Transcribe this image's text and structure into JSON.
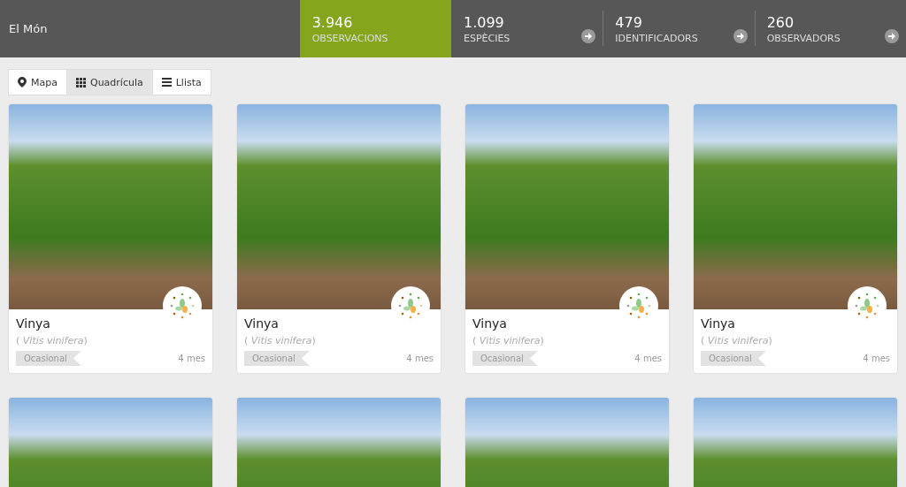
{
  "header": {
    "place": "El Món",
    "stats": [
      {
        "value": "3.946",
        "label": "OBSERVACIONS",
        "selected": true
      },
      {
        "value": "1.099",
        "label": "ESPÈCIES",
        "selected": false
      },
      {
        "value": "479",
        "label": "IDENTIFICADORS",
        "selected": false
      },
      {
        "value": "260",
        "label": "OBSERVADORS",
        "selected": false
      }
    ]
  },
  "view_tabs": [
    {
      "label": "Mapa",
      "kind": "map",
      "selected": false
    },
    {
      "label": "Quadrícula",
      "kind": "grid",
      "selected": true
    },
    {
      "label": "Llista",
      "kind": "list",
      "selected": false
    }
  ],
  "cards": [
    {
      "kind": "full",
      "name": "Vinya",
      "scientific": "( *Vitis vinifera*)",
      "tag": "Ocasional",
      "age": "4 mes"
    },
    {
      "kind": "full",
      "name": "Vinya",
      "scientific": "( *Vitis vinifera*)",
      "tag": "Ocasional",
      "age": "4 mes"
    },
    {
      "kind": "full",
      "name": "Vinya",
      "scientific": "( *Vitis vinifera*)",
      "tag": "Ocasional",
      "age": "4 mes"
    },
    {
      "kind": "full",
      "name": "Vinya",
      "scientific": "( *Vitis vinifera*)",
      "tag": "Ocasional",
      "age": "4 mes"
    },
    {
      "kind": "photo"
    },
    {
      "kind": "photo"
    },
    {
      "kind": "photo"
    },
    {
      "kind": "photo"
    }
  ]
}
